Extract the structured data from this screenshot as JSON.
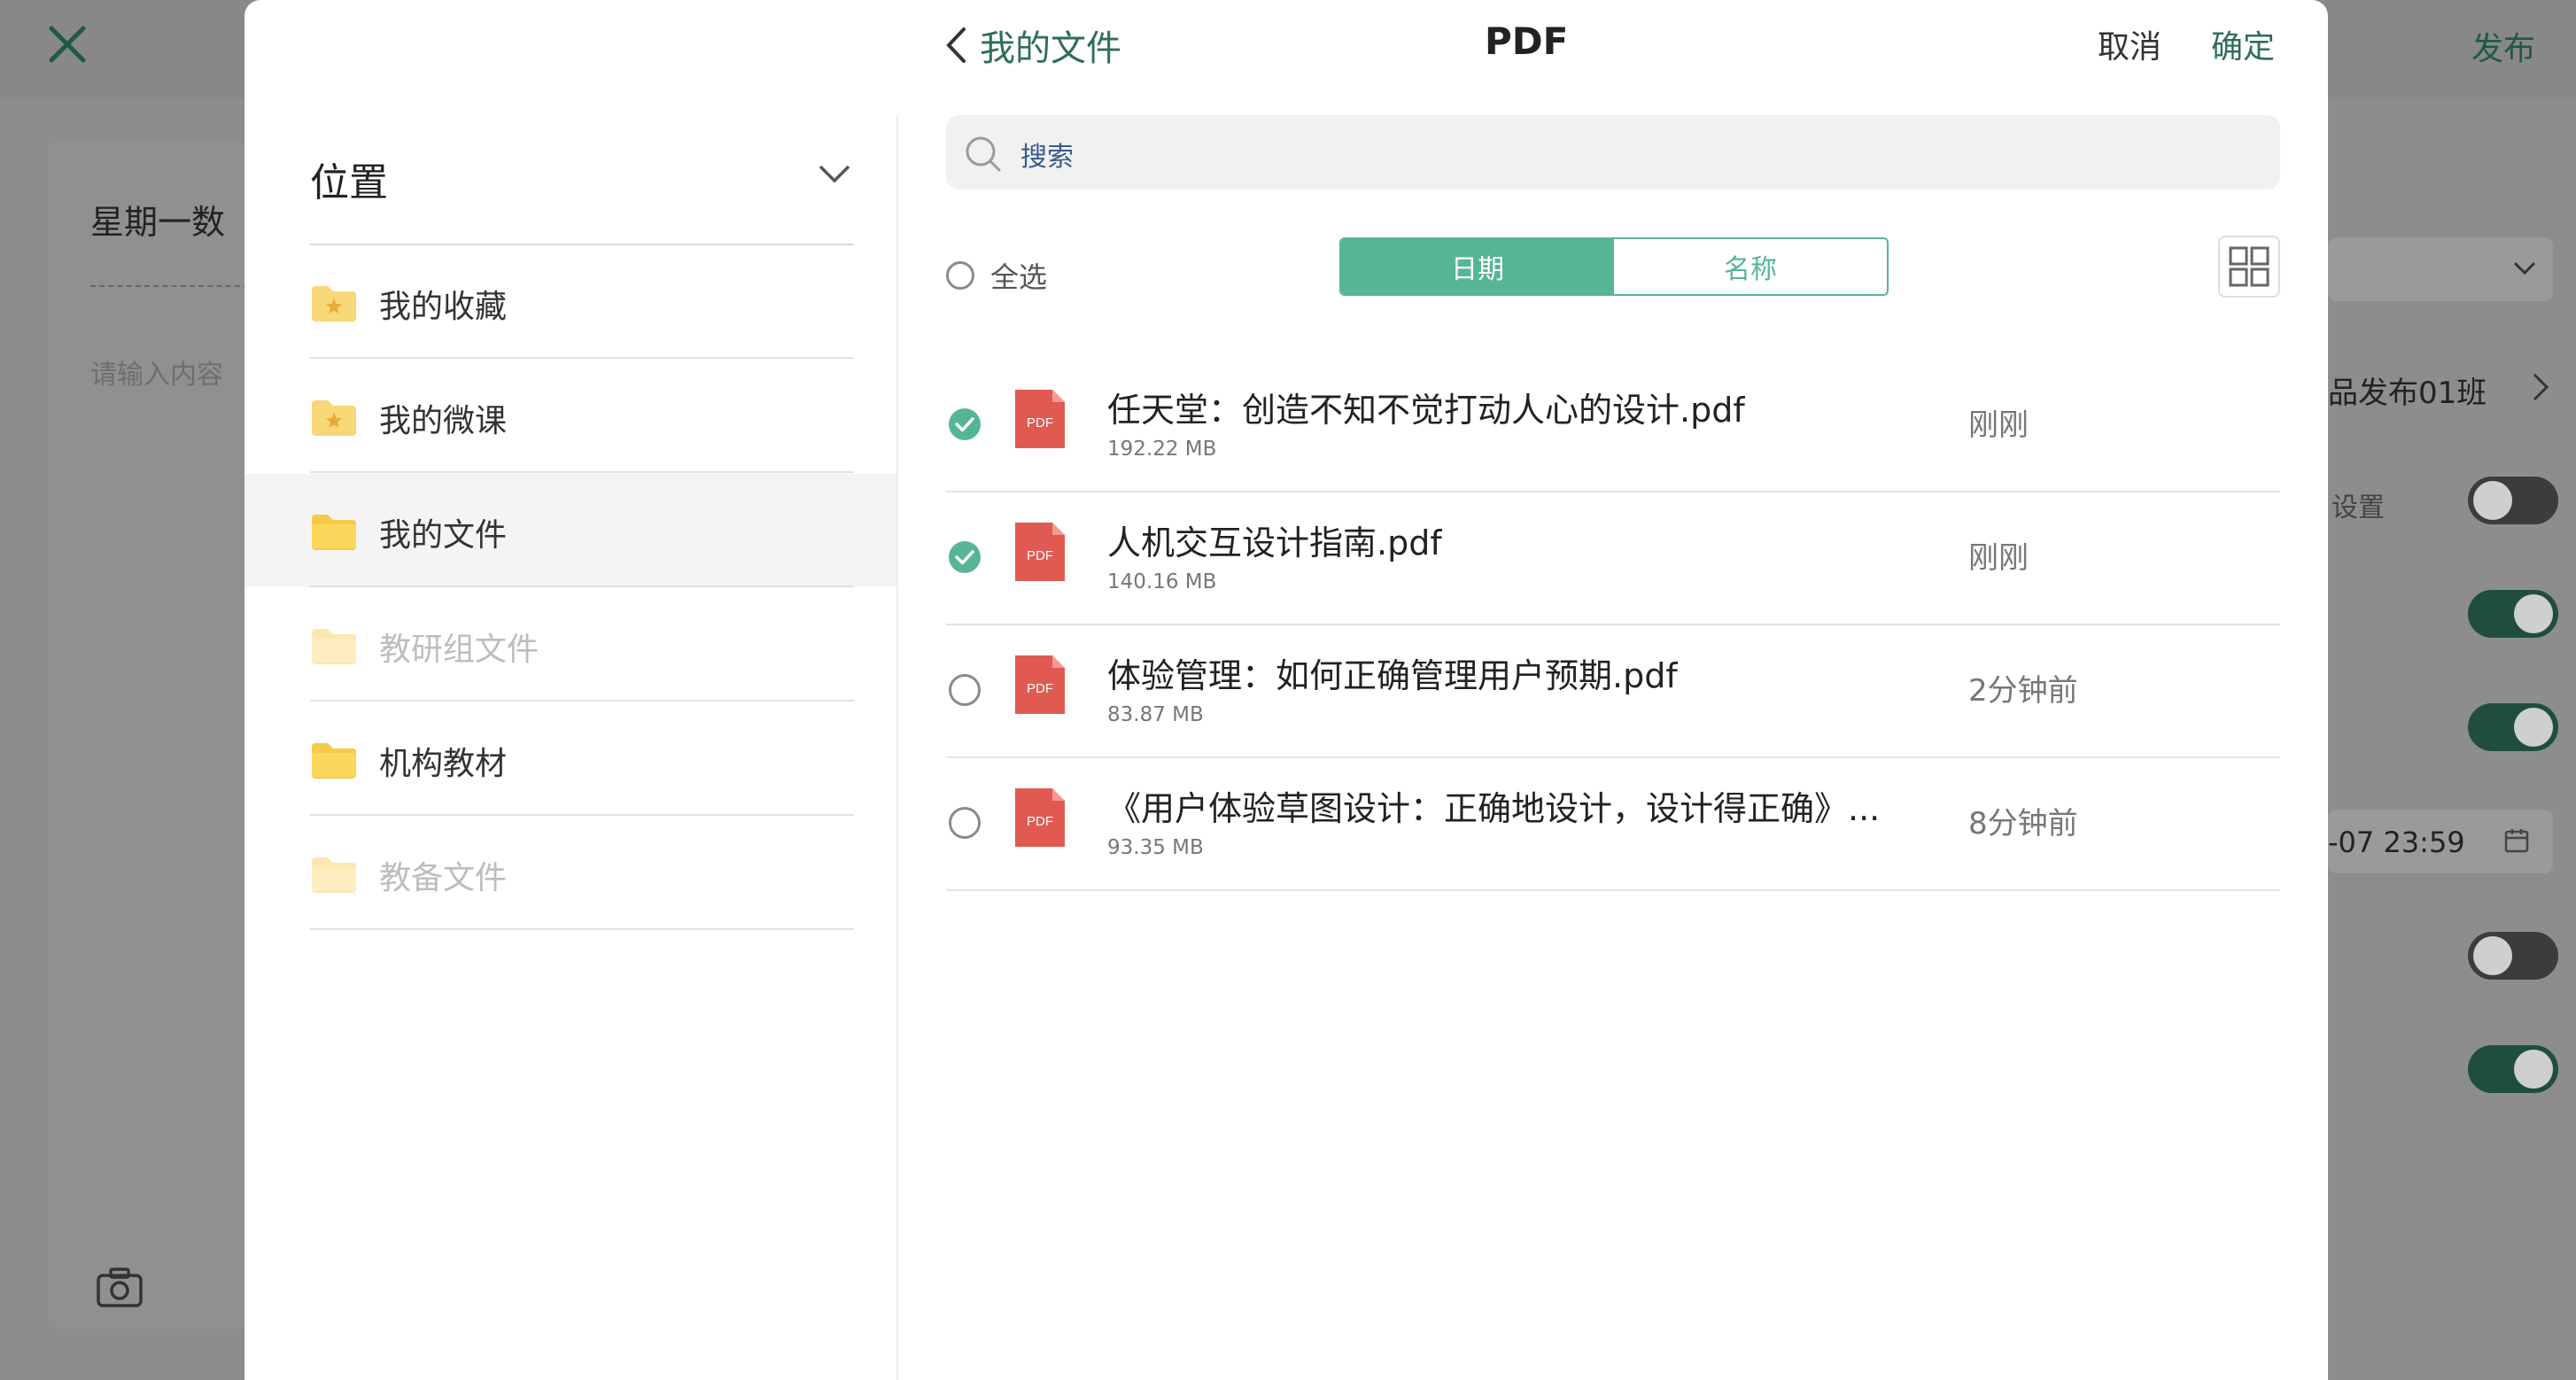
{
  "background": {
    "publish_label": "发布",
    "card_title": "星期一数",
    "input_placeholder": "请输入内容",
    "class_label": "品发布01班",
    "setting_label": "设置",
    "deadline": "-07 23:59"
  },
  "header": {
    "back_label": "我的文件",
    "title": "PDF",
    "cancel_label": "取消",
    "confirm_label": "确定"
  },
  "sidebar": {
    "title": "位置",
    "items": [
      {
        "label": "我的收藏"
      },
      {
        "label": "我的微课"
      },
      {
        "label": "我的文件"
      },
      {
        "label": "教研组文件"
      },
      {
        "label": "机构教材"
      },
      {
        "label": "教备文件"
      }
    ]
  },
  "search": {
    "placeholder": "搜索"
  },
  "toolbar": {
    "select_all": "全选",
    "sort_date": "日期",
    "sort_name": "名称"
  },
  "files": [
    {
      "name": "任天堂：创造不知不觉打动人心的设计.pdf",
      "size": "192.22 MB",
      "time": "刚刚",
      "checked": true
    },
    {
      "name": "人机交互设计指南.pdf",
      "size": "140.16 MB",
      "time": "刚刚",
      "checked": true
    },
    {
      "name": "体验管理：如何正确管理用户预期.pdf",
      "size": "83.87 MB",
      "time": "2分钟前",
      "checked": false
    },
    {
      "name": "《用户体验草图设计：正确地设计，设计得正确》...",
      "size": "93.35 MB",
      "time": "8分钟前",
      "checked": false
    }
  ],
  "colors": {
    "accent": "#57b597",
    "accent_dark": "#2e6e57",
    "pdf_red": "#e05a52",
    "folder": "#f7c948"
  },
  "pdf_icon_text": "PDF"
}
